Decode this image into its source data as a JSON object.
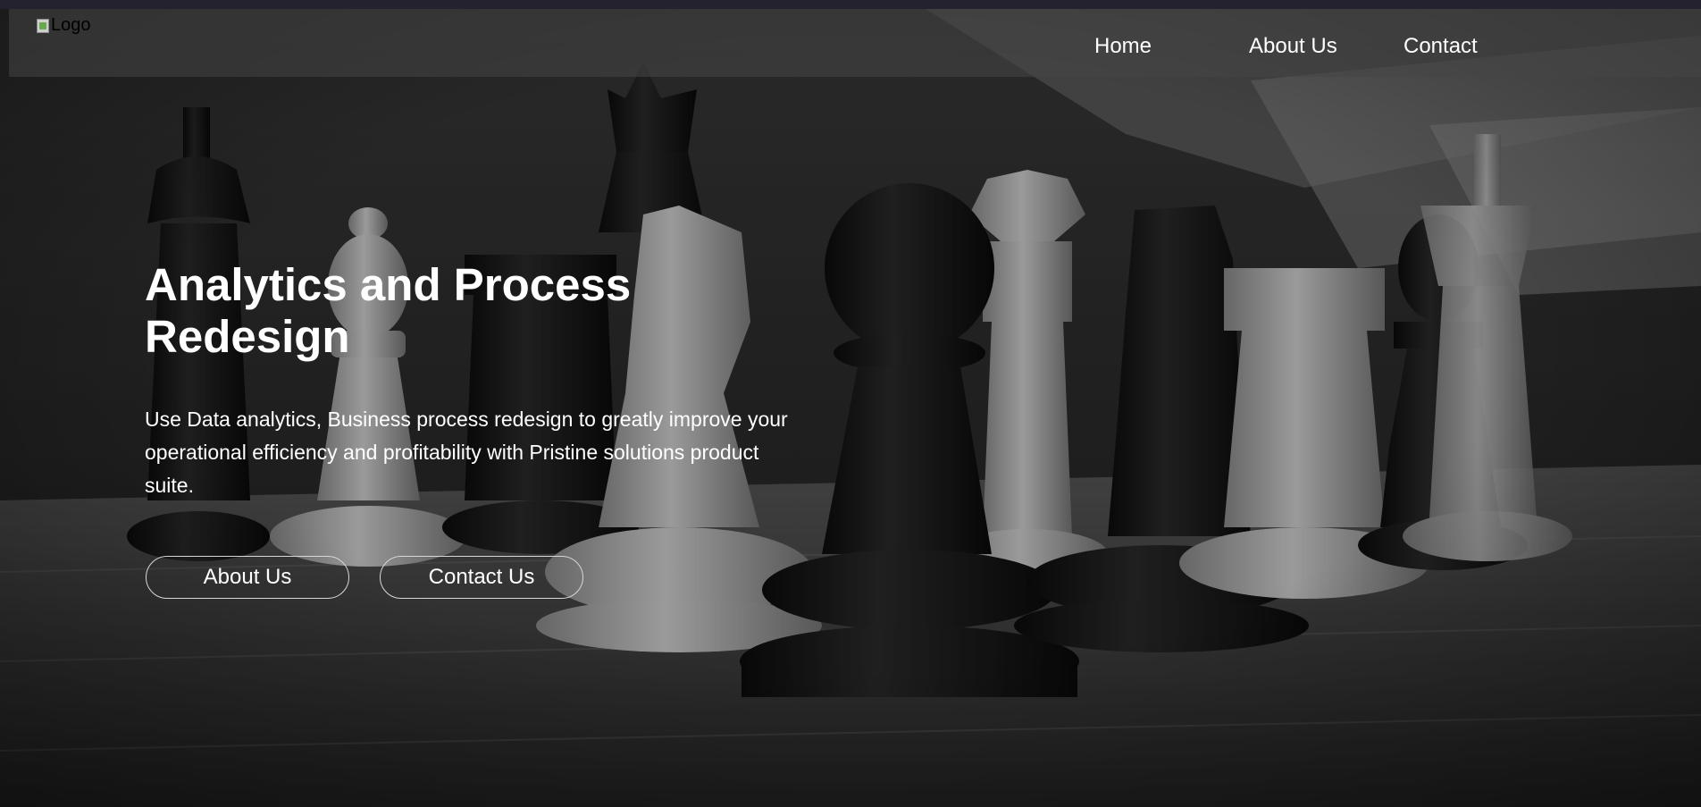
{
  "header": {
    "logo_alt": "Logo",
    "nav": [
      "Home",
      "About Us",
      "Contact"
    ]
  },
  "hero": {
    "title_line1": "Analytics and Process",
    "title_line2": "Redesign",
    "description": "Use Data analytics, Business process redesign to greatly improve your operational efficiency and profitability with Pristine solutions product suite.",
    "primary_button": "About Us",
    "secondary_button": "Contact Us"
  },
  "colors": {
    "text": "#ffffff",
    "navbar_bg": "#464646",
    "button_border": "#d8d8d8"
  }
}
